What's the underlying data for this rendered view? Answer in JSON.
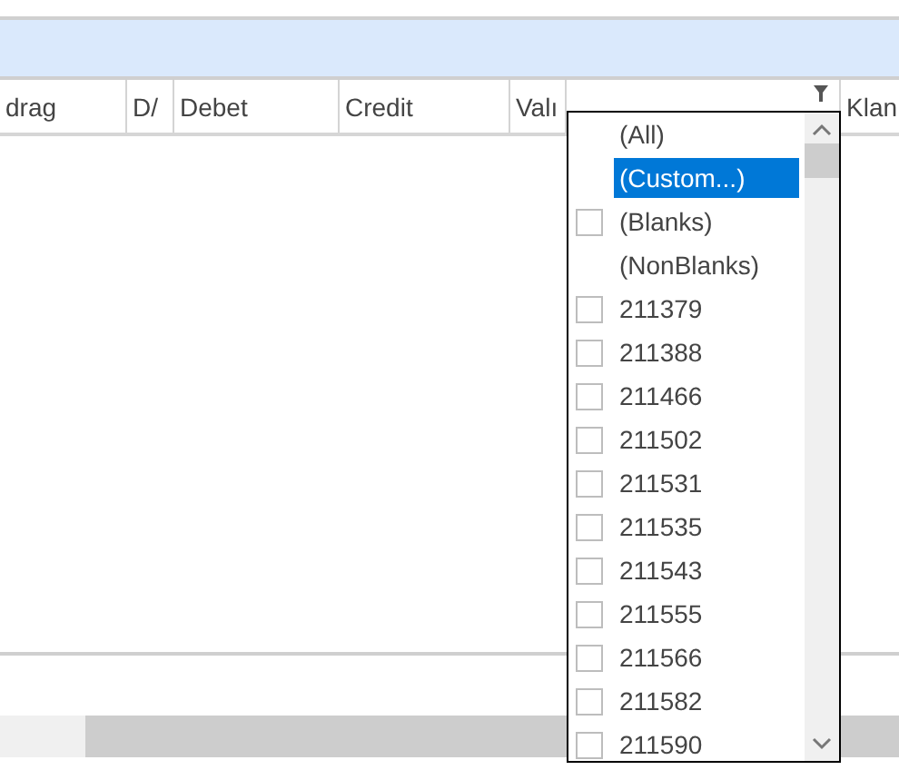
{
  "grid": {
    "columns": [
      {
        "label": "drag"
      },
      {
        "label": "D/"
      },
      {
        "label": "Debet"
      },
      {
        "label": "Credit"
      },
      {
        "label": "Valı"
      },
      {
        "filter": true
      },
      {
        "label": "Klan"
      }
    ]
  },
  "filter_popup": {
    "items": [
      {
        "kind": "plain",
        "label": "(All)",
        "selected": false
      },
      {
        "kind": "plain",
        "label": "(Custom...)",
        "selected": true
      },
      {
        "kind": "checkbox",
        "label": "(Blanks)",
        "checked": false,
        "selected": false
      },
      {
        "kind": "plain",
        "label": "(NonBlanks)",
        "selected": false
      },
      {
        "kind": "checkbox",
        "label": "211379",
        "checked": false,
        "selected": false
      },
      {
        "kind": "checkbox",
        "label": "211388",
        "checked": false,
        "selected": false
      },
      {
        "kind": "checkbox",
        "label": "211466",
        "checked": false,
        "selected": false
      },
      {
        "kind": "checkbox",
        "label": "211502",
        "checked": false,
        "selected": false
      },
      {
        "kind": "checkbox",
        "label": "211531",
        "checked": false,
        "selected": false
      },
      {
        "kind": "checkbox",
        "label": "211535",
        "checked": false,
        "selected": false
      },
      {
        "kind": "checkbox",
        "label": "211543",
        "checked": false,
        "selected": false
      },
      {
        "kind": "checkbox",
        "label": "211555",
        "checked": false,
        "selected": false
      },
      {
        "kind": "checkbox",
        "label": "211566",
        "checked": false,
        "selected": false
      },
      {
        "kind": "checkbox",
        "label": "211582",
        "checked": false,
        "selected": false
      },
      {
        "kind": "checkbox",
        "label": "211590",
        "checked": false,
        "selected": false
      }
    ]
  }
}
